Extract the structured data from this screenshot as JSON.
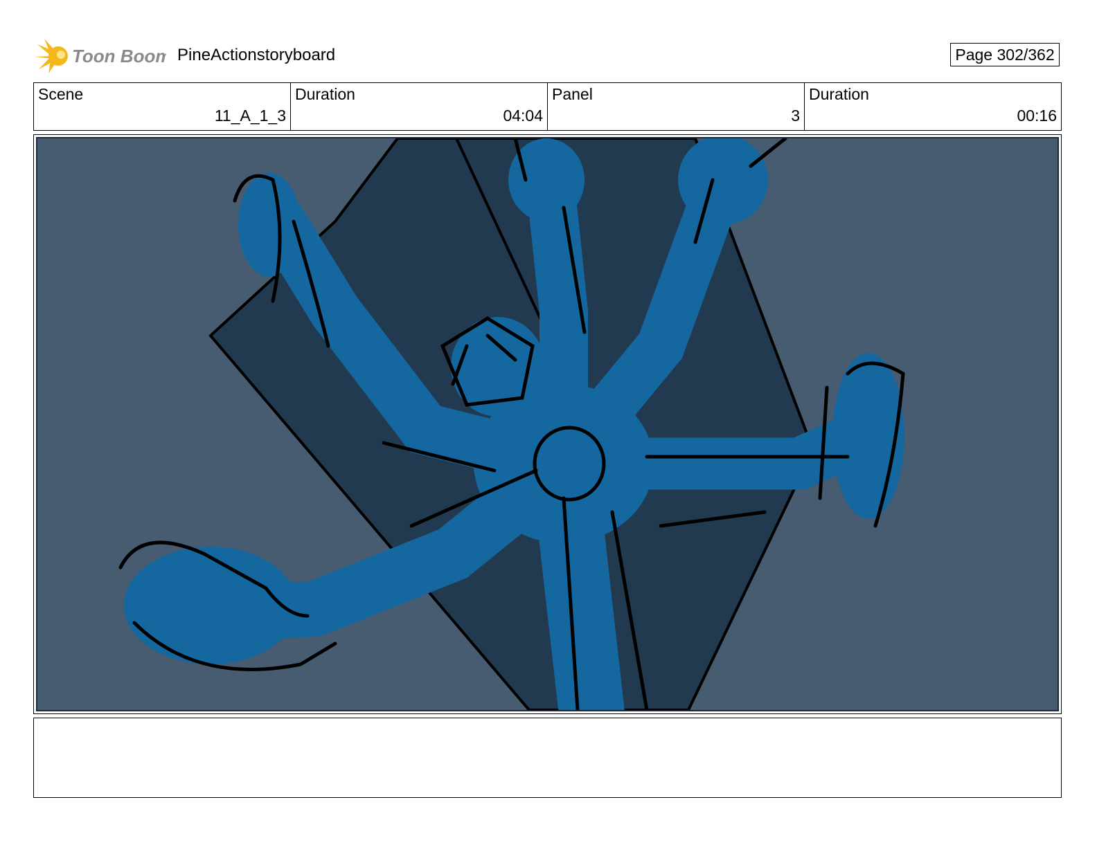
{
  "header": {
    "brand_name": "Toon Boom",
    "project_title": "PineActionstoryboard",
    "page_label": "Page 302/362"
  },
  "info": [
    {
      "label": "Scene",
      "value": "11_A_1_3"
    },
    {
      "label": "Duration",
      "value": "04:04"
    },
    {
      "label": "Panel",
      "value": "3"
    },
    {
      "label": "Duration",
      "value": "00:16"
    }
  ],
  "panel": {
    "image": "storyboard-sketch",
    "colors": {
      "background": "#475c70",
      "shadow": "#223a50",
      "figure": "#1567a0",
      "ink": "#000000"
    }
  },
  "notes": ""
}
